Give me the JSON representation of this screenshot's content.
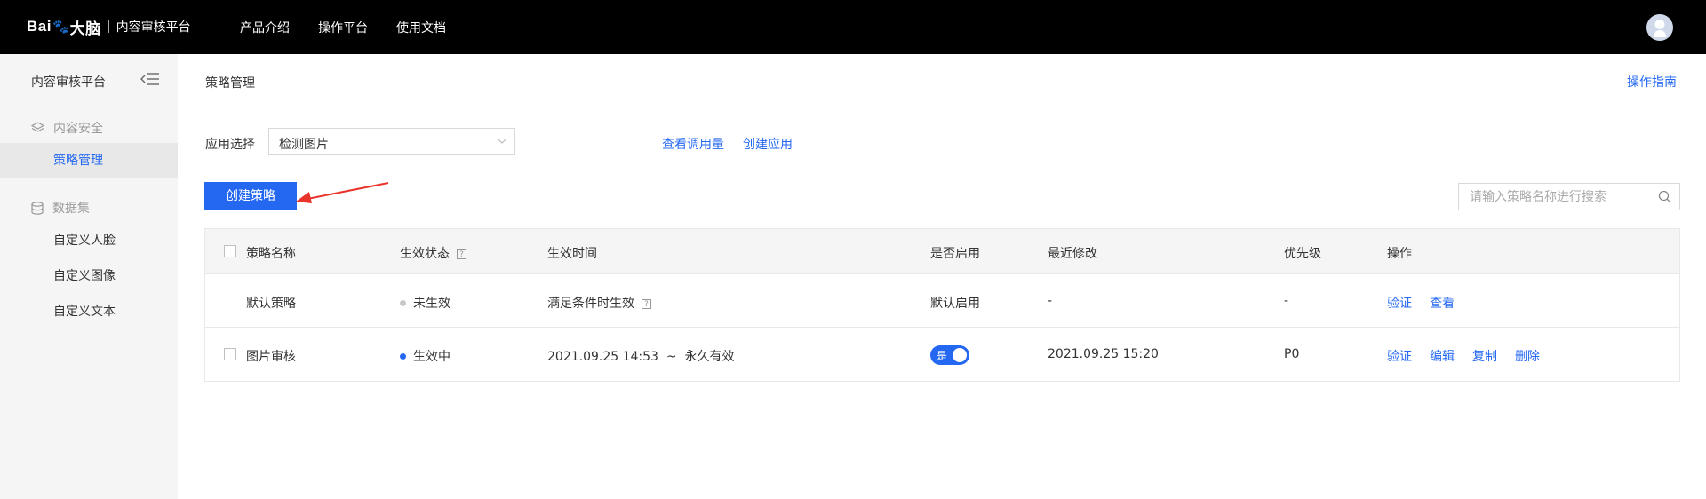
{
  "topbar": {
    "logo_text": "Bai",
    "logo_paw": "🐾",
    "logo_brain": "大脑",
    "logo_subtitle": "内容审核平台",
    "nav": [
      "产品介绍",
      "操作平台",
      "使用文档"
    ]
  },
  "sidebar": {
    "title": "内容审核平台",
    "groups": [
      {
        "label": "内容安全",
        "items": [
          {
            "label": "策略管理",
            "active": true
          }
        ]
      },
      {
        "label": "数据集",
        "items": [
          {
            "label": "自定义人脸"
          },
          {
            "label": "自定义图像"
          },
          {
            "label": "自定义文本"
          }
        ]
      }
    ]
  },
  "main": {
    "page_title": "策略管理",
    "guide_link": "操作指南",
    "app_label": "应用选择",
    "app_select_value": "检测图片",
    "links": {
      "view_usage": "查看调用量",
      "create_app": "创建应用"
    },
    "create_button": "创建策略",
    "search_placeholder": "请输入策略名称进行搜索"
  },
  "table": {
    "headers": [
      "策略名称",
      "生效状态",
      "生效时间",
      "是否启用",
      "最近修改",
      "优先级",
      "操作"
    ],
    "rows": [
      {
        "name": "默认策略",
        "status": "未生效",
        "status_color": "#c8c8c8",
        "time": "满足条件时生效",
        "enabled": "默认启用",
        "modified": "-",
        "priority": "-",
        "actions": [
          "验证",
          "查看"
        ]
      },
      {
        "name": "图片审核",
        "status": "生效中",
        "status_color": "#2468f2",
        "time": "2021.09.25 14:53  ~  永久有效",
        "enabled_toggle": "是",
        "modified": "2021.09.25 15:20",
        "priority": "P0",
        "actions": [
          "验证",
          "编辑",
          "复制",
          "删除"
        ]
      }
    ]
  },
  "colors": {
    "accent": "#2468f2",
    "topbar": "#000000",
    "sidebar": "#f5f5f5",
    "arrow": "#e8342a"
  }
}
